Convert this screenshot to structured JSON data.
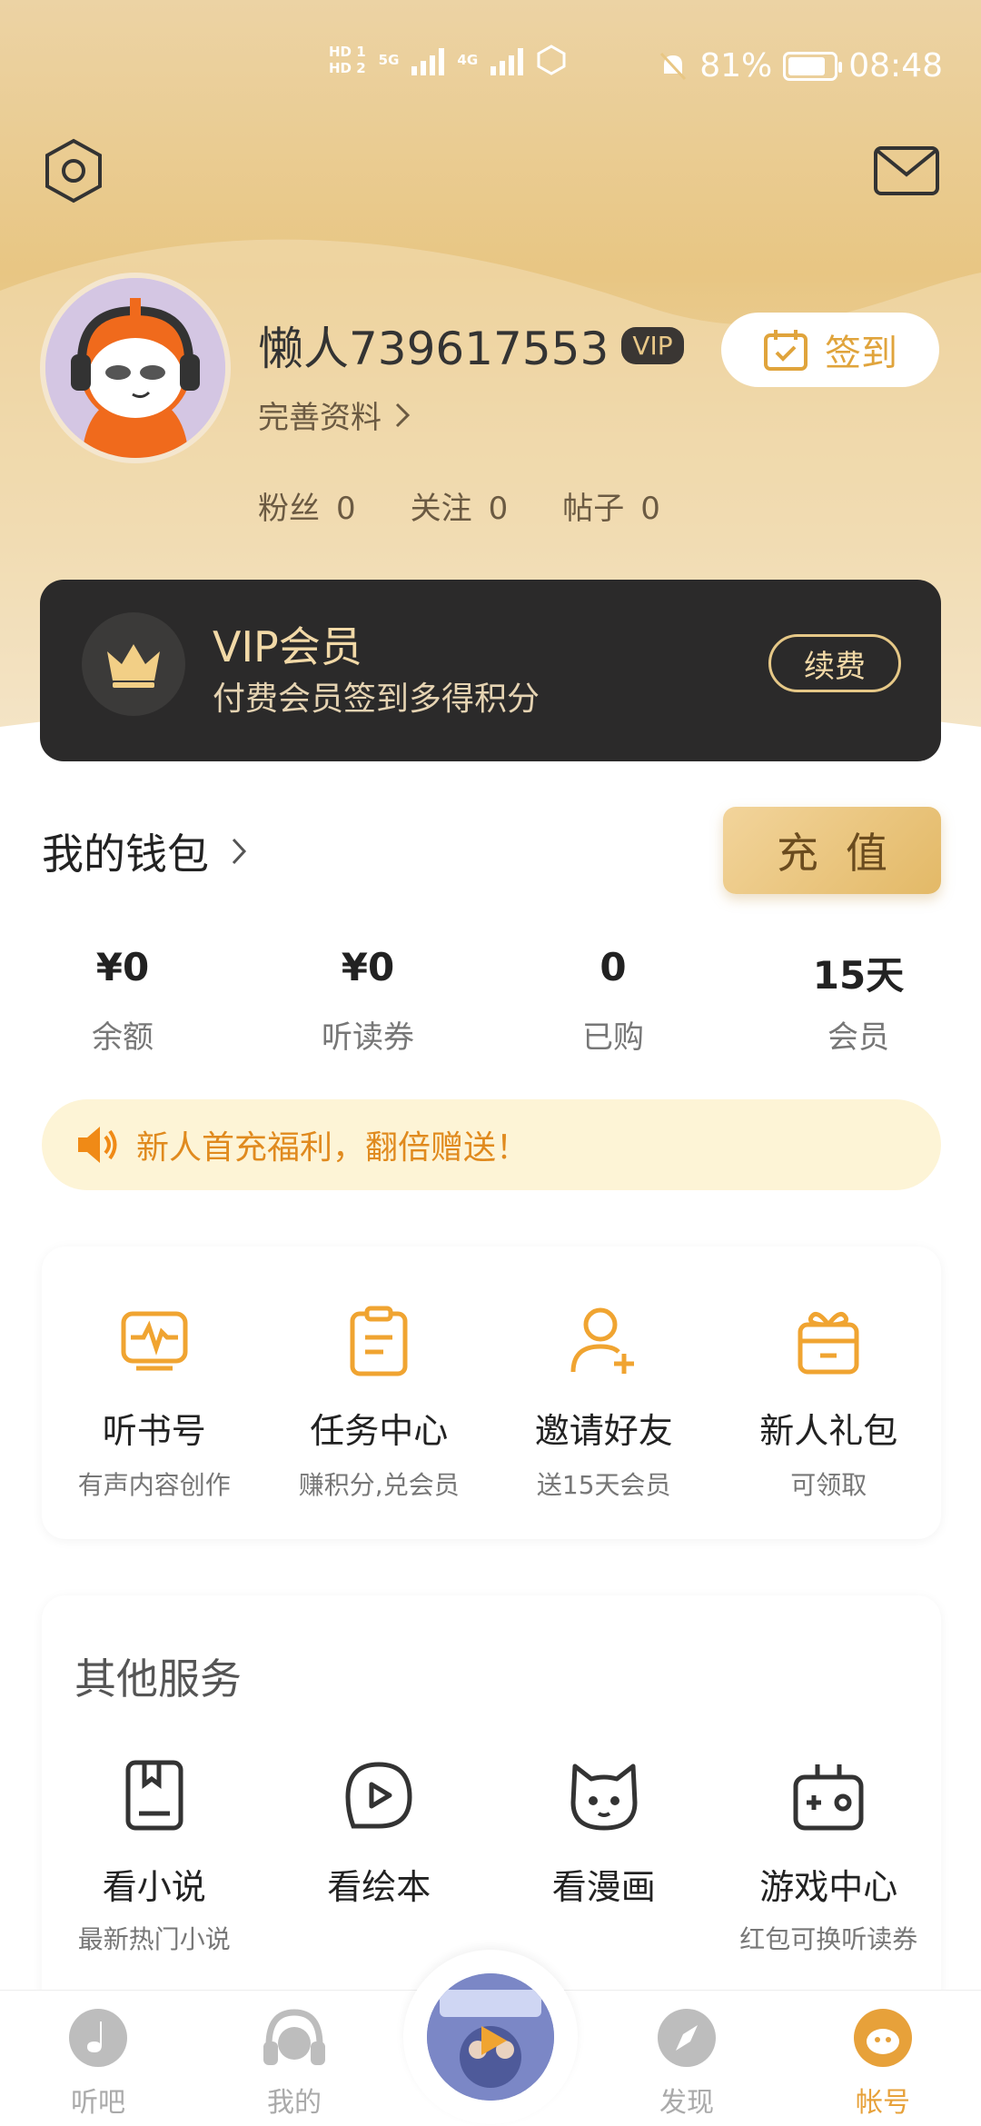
{
  "status_bar": {
    "battery": "81%",
    "time": "08:48",
    "network_left": "5G",
    "network_right": "4G"
  },
  "profile": {
    "username": "懒人739617553",
    "vip_tag": "VIP",
    "edit_profile": "完善资料",
    "checkin": "签到",
    "stats": [
      {
        "label": "粉丝",
        "value": "0"
      },
      {
        "label": "关注",
        "value": "0"
      },
      {
        "label": "帖子",
        "value": "0"
      }
    ]
  },
  "vip_card": {
    "title": "VIP会员",
    "subtitle": "付费会员签到多得积分",
    "renew": "续费"
  },
  "wallet": {
    "title": "我的钱包",
    "recharge": "充值",
    "items": [
      {
        "value": "¥0",
        "label": "余额"
      },
      {
        "value": "¥0",
        "label": "听读券"
      },
      {
        "value": "0",
        "label": "已购"
      },
      {
        "value": "15天",
        "label": "会员"
      }
    ]
  },
  "promo": {
    "text": "新人首充福利，翻倍赠送！"
  },
  "features": [
    {
      "title": "听书号",
      "sub": "有声内容创作",
      "icon": "audio-wave-icon"
    },
    {
      "title": "任务中心",
      "sub": "赚积分,兑会员",
      "icon": "clipboard-icon"
    },
    {
      "title": "邀请好友",
      "sub": "送15天会员",
      "icon": "add-user-icon"
    },
    {
      "title": "新人礼包",
      "sub": "可领取",
      "icon": "gift-icon"
    }
  ],
  "services": {
    "title": "其他服务",
    "items": [
      {
        "title": "看小说",
        "sub": "最新热门小说",
        "icon": "book-icon"
      },
      {
        "title": "看绘本",
        "sub": "",
        "icon": "play-bubble-icon"
      },
      {
        "title": "看漫画",
        "sub": "",
        "icon": "cat-face-icon"
      },
      {
        "title": "游戏中心",
        "sub": "红包可换听读券",
        "icon": "gamepad-icon"
      }
    ]
  },
  "tabbar": {
    "items": [
      {
        "label": "听吧",
        "active": false
      },
      {
        "label": "我的",
        "active": false
      },
      {
        "label": "",
        "active": false
      },
      {
        "label": "发现",
        "active": false
      },
      {
        "label": "帐号",
        "active": true
      }
    ]
  },
  "colors": {
    "accent": "#E7A13A",
    "gold": "#E8C683",
    "vip_dark": "#2B2A2A"
  }
}
